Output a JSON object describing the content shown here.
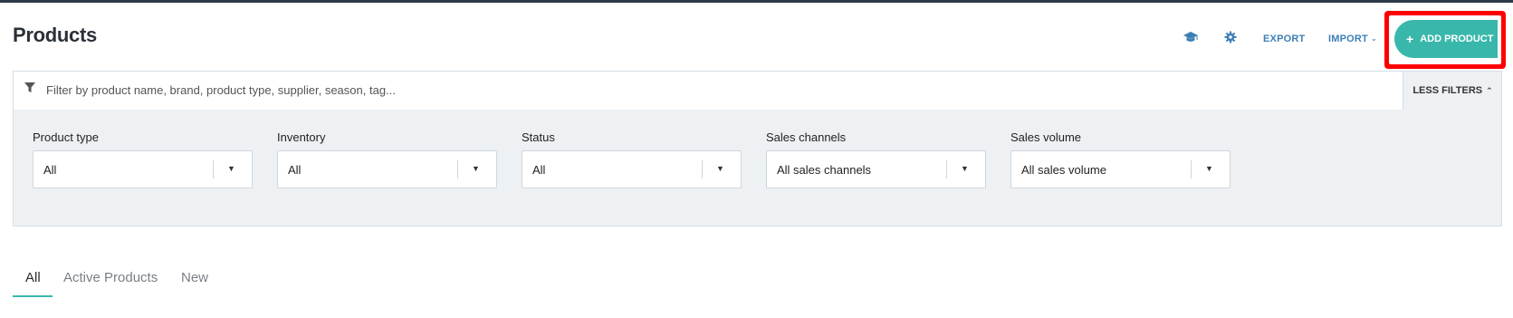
{
  "page": {
    "title": "Products"
  },
  "toolbar": {
    "help_icon": "graduation-cap-icon",
    "settings_icon": "gear-icon",
    "export_label": "EXPORT",
    "import_label": "IMPORT",
    "add_product_label": "ADD PRODUCT"
  },
  "filters": {
    "search_placeholder": "Filter by product name, brand, product type, supplier, season, tag...",
    "less_filters_label": "LESS FILTERS",
    "groups": [
      {
        "label": "Product type",
        "value": "All"
      },
      {
        "label": "Inventory",
        "value": "All"
      },
      {
        "label": "Status",
        "value": "All"
      },
      {
        "label": "Sales channels",
        "value": "All sales channels"
      },
      {
        "label": "Sales volume",
        "value": "All sales volume"
      }
    ]
  },
  "tabs": [
    {
      "label": "All",
      "active": true
    },
    {
      "label": "Active Products",
      "active": false
    },
    {
      "label": "New",
      "active": false
    }
  ],
  "colors": {
    "accent": "#39b7ab",
    "link": "#3d7fb5",
    "highlight": "#ff0000",
    "panel_bg": "#eef1f4"
  }
}
